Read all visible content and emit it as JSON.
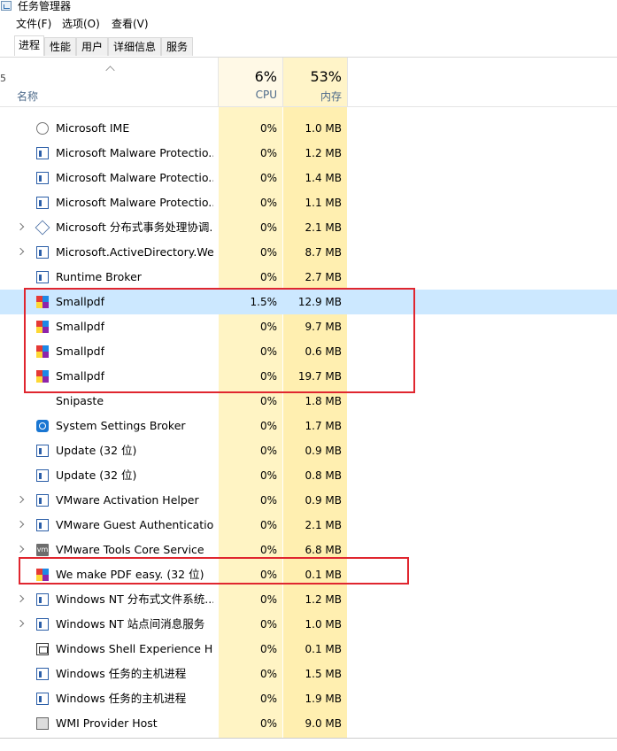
{
  "window": {
    "title": "任务管理器"
  },
  "menu": [
    "文件(F)",
    "选项(O)",
    "查看(V)"
  ],
  "tabs": [
    "进程",
    "性能",
    "用户",
    "详细信息",
    "服务"
  ],
  "active_tab": "进程",
  "header": {
    "name": "名称",
    "cpu_pct": "6%",
    "cpu_label": "CPU",
    "mem_pct": "53%",
    "mem_label": "内存"
  },
  "left_edge_text": "5",
  "rows": [
    {
      "name": "Microsoft IME",
      "cpu": "0%",
      "mem": "1.0 MB",
      "icon": "ime-icon",
      "expandable": false
    },
    {
      "name": "Microsoft Malware Protectio...",
      "cpu": "0%",
      "mem": "1.2 MB",
      "icon": "window-app-icon",
      "expandable": false
    },
    {
      "name": "Microsoft Malware Protectio...",
      "cpu": "0%",
      "mem": "1.4 MB",
      "icon": "window-app-icon",
      "expandable": false
    },
    {
      "name": "Microsoft Malware Protectio...",
      "cpu": "0%",
      "mem": "1.1 MB",
      "icon": "window-app-icon",
      "expandable": false
    },
    {
      "name": "Microsoft 分布式事务处理协调...",
      "cpu": "0%",
      "mem": "2.1 MB",
      "icon": "distributed-icon",
      "expandable": true
    },
    {
      "name": "Microsoft.ActiveDirectory.We...",
      "cpu": "0%",
      "mem": "8.7 MB",
      "icon": "window-app-icon",
      "expandable": true
    },
    {
      "name": "Runtime Broker",
      "cpu": "0%",
      "mem": "2.7 MB",
      "icon": "window-app-icon",
      "expandable": false
    },
    {
      "name": "Smallpdf",
      "cpu": "1.5%",
      "mem": "12.9 MB",
      "icon": "smallpdf-icon",
      "expandable": false,
      "selected": true
    },
    {
      "name": "Smallpdf",
      "cpu": "0%",
      "mem": "9.7 MB",
      "icon": "smallpdf-icon",
      "expandable": false
    },
    {
      "name": "Smallpdf",
      "cpu": "0%",
      "mem": "0.6 MB",
      "icon": "smallpdf-icon",
      "expandable": false
    },
    {
      "name": "Smallpdf",
      "cpu": "0%",
      "mem": "19.7 MB",
      "icon": "smallpdf-icon",
      "expandable": false
    },
    {
      "name": "Snipaste",
      "cpu": "0%",
      "mem": "1.8 MB",
      "icon": "none",
      "expandable": false
    },
    {
      "name": "System Settings Broker",
      "cpu": "0%",
      "mem": "1.7 MB",
      "icon": "settings-gear-icon",
      "expandable": false
    },
    {
      "name": "Update (32 位)",
      "cpu": "0%",
      "mem": "0.9 MB",
      "icon": "window-app-icon",
      "expandable": false
    },
    {
      "name": "Update (32 位)",
      "cpu": "0%",
      "mem": "0.8 MB",
      "icon": "window-app-icon",
      "expandable": false
    },
    {
      "name": "VMware Activation Helper",
      "cpu": "0%",
      "mem": "0.9 MB",
      "icon": "window-app-icon",
      "expandable": true
    },
    {
      "name": "VMware Guest Authenticatio...",
      "cpu": "0%",
      "mem": "2.1 MB",
      "icon": "window-app-icon",
      "expandable": true
    },
    {
      "name": "VMware Tools Core Service",
      "cpu": "0%",
      "mem": "6.8 MB",
      "icon": "vm-icon",
      "expandable": true
    },
    {
      "name": "We make PDF easy. (32 位)",
      "cpu": "0%",
      "mem": "0.1 MB",
      "icon": "smallpdf-icon",
      "expandable": false
    },
    {
      "name": "Windows NT 分布式文件系统...",
      "cpu": "0%",
      "mem": "1.2 MB",
      "icon": "window-app-icon",
      "expandable": true
    },
    {
      "name": "Windows NT 站点间消息服务",
      "cpu": "0%",
      "mem": "1.0 MB",
      "icon": "window-app-icon",
      "expandable": true
    },
    {
      "name": "Windows Shell Experience H...",
      "cpu": "0%",
      "mem": "0.1 MB",
      "icon": "shell-icon",
      "expandable": false
    },
    {
      "name": "Windows 任务的主机进程",
      "cpu": "0%",
      "mem": "1.5 MB",
      "icon": "window-app-icon",
      "expandable": false
    },
    {
      "name": "Windows 任务的主机进程",
      "cpu": "0%",
      "mem": "1.9 MB",
      "icon": "window-app-icon",
      "expandable": false
    },
    {
      "name": "WMI Provider Host",
      "cpu": "0%",
      "mem": "9.0 MB",
      "icon": "wmi-icon",
      "expandable": false
    }
  ],
  "colors": {
    "highlight_box": "#e0262f",
    "selected_row": "#cce8ff",
    "cpu_column": "#fff4c4",
    "mem_column": "#ffefb0"
  }
}
